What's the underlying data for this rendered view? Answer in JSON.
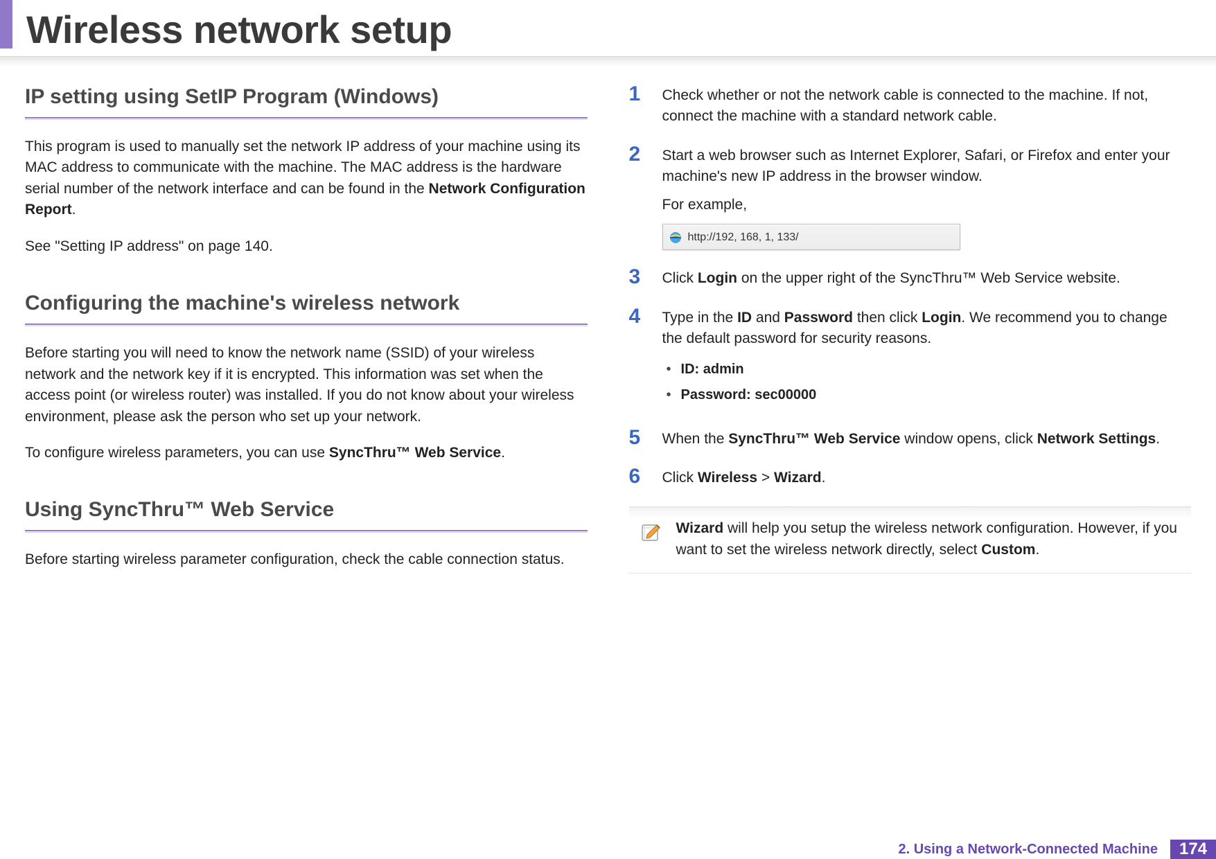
{
  "page_title": "Wireless network setup",
  "footer": {
    "chapter": "2.  Using a Network-Connected Machine",
    "page": "174"
  },
  "left": {
    "h1": "IP setting using SetIP Program (Windows)",
    "p1a": "This program is used to manually set the network IP address of your machine using its MAC address to communicate with the machine. The MAC address is the hardware serial number of the network interface and can be found in the ",
    "p1b_bold": "Network Configuration Report",
    "p1c": ".",
    "p2": "See \"Setting IP address\" on page 140.",
    "h2": "Configuring the machine's wireless network",
    "p3": "Before starting you will need to know the network name (SSID) of your wireless network and the network key if it is encrypted. This information was set when the access point (or wireless router) was installed. If you do not know about your wireless environment, please ask the person who set up your network.",
    "p4a": "To configure wireless parameters, you can use ",
    "p4b_bold": "SyncThru™ Web Service",
    "p4c": ".",
    "h3": "Using SyncThru™ Web Service",
    "p5": "Before starting wireless parameter configuration, check the cable connection status."
  },
  "right": {
    "s1": {
      "num": "1",
      "text": "Check whether or not the network cable is connected to the machine. If not, connect the machine with a standard network cable."
    },
    "s2": {
      "num": "2",
      "t1": "Start a web browser such as Internet Explorer, Safari, or Firefox and enter your machine's new IP address in the browser window.",
      "t2": "For example,",
      "url": "http://192, 168, 1, 133/"
    },
    "s3": {
      "num": "3",
      "a": "Click ",
      "b_bold": "Login",
      "c": " on the upper right of the SyncThru™ Web Service website."
    },
    "s4": {
      "num": "4",
      "a": "Type in the ",
      "b1": "ID",
      "mid": " and ",
      "b2": "Password",
      "c": " then click ",
      "b3": "Login",
      "d": ". We recommend you to change the default password for security reasons.",
      "bullet1": "ID: admin",
      "bullet2": "Password: sec00000"
    },
    "s5": {
      "num": "5",
      "a": "When the ",
      "b1": "SyncThru™ Web Service",
      "c": " window opens, click ",
      "b2": "Network Settings",
      "d": "."
    },
    "s6": {
      "num": "6",
      "a": "Click ",
      "b1": "Wireless",
      "mid": " > ",
      "b2": "Wizard",
      "d": "."
    },
    "note": {
      "a_bold": "Wizard",
      "b": " will help you setup the wireless network configuration. However, if you want to set the wireless network directly, select ",
      "c_bold": "Custom",
      "d": "."
    }
  }
}
